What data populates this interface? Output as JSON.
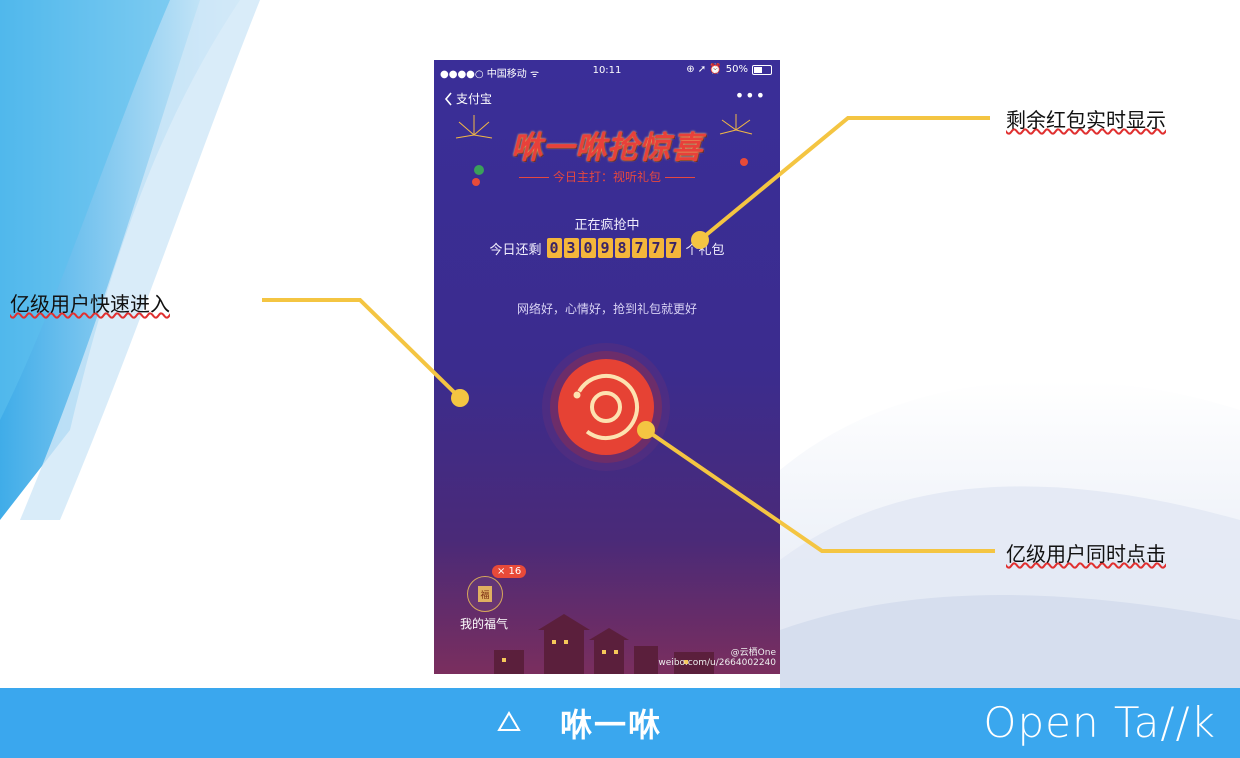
{
  "phone": {
    "status_bar": {
      "carrier": "●●●●○ 中国移动 ᯤ",
      "time": "10:11",
      "icons": "⊕ ➚ ⏰",
      "battery_percent": "50%",
      "battery_level": 0.5
    },
    "nav": {
      "back_label": "支付宝",
      "more": "•••"
    },
    "event_title": "咻一咻抢惊喜",
    "event_subtitle": "今日主打：视听礼包",
    "grab_status": "正在疯抢中",
    "remaining_prefix": "今日还剩",
    "remaining_digits": [
      "0",
      "3",
      "0",
      "9",
      "8",
      "7",
      "7",
      "7"
    ],
    "remaining_suffix": "个礼包",
    "slogan": "网络好，心情好，抢到礼包就更好",
    "fortune": {
      "label": "我的福气",
      "badge": "× 16",
      "icon_char": "福"
    },
    "watermark": {
      "handle": "@云栖One",
      "url": "weibo.com/u/2664002240"
    }
  },
  "callouts": {
    "realtime": "剩余红包实时显示",
    "enter": "亿级用户快速进入",
    "click": "亿级用户同时点击"
  },
  "bottom_bar": {
    "title": "咻一咻",
    "brand": "Open Ta//k"
  },
  "colors": {
    "callout_line": "#f4c542",
    "bottom_bar": "#3aa7ee",
    "digit_bg": "#f4b63b"
  }
}
